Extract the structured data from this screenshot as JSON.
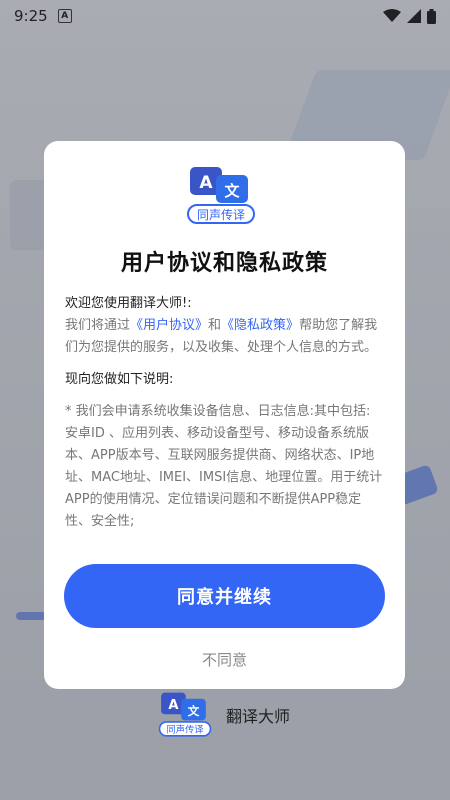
{
  "status_bar": {
    "time": "9:25"
  },
  "dialog": {
    "logo": {
      "badge_left": "A",
      "badge_right": "文",
      "ribbon": "同声传译"
    },
    "title": "用户协议和隐私政策",
    "welcome": "欢迎您使用翻译大师!:",
    "intro_prefix": "我们将通过",
    "link_user_agreement": "《用户协议》",
    "intro_and": "和",
    "link_privacy_policy": "《隐私政策》",
    "intro_suffix": "帮助您了解我们为您提供的服务，以及收集、处理个人信息的方式。",
    "explain_heading": "现向您做如下说明:",
    "body_text": "* 我们会申请系统收集设备信息、日志信息:其中包括: 安卓ID 、应用列表、移动设备型号、移动设备系统版本、APP版本号、互联网服务提供商、网络状态、IP地址、MAC地址、IMEI、IMSI信息、地理位置。用于统计APP的使用情况、定位错误问题和不断提供APP稳定性、安全性;",
    "agree_button": "同意并继续",
    "disagree_button": "不同意"
  },
  "background_brand": {
    "logo": {
      "badge_left": "A",
      "badge_right": "文",
      "ribbon": "同声传译"
    },
    "name": "翻译大师"
  },
  "colors": {
    "accent": "#3466f6"
  }
}
